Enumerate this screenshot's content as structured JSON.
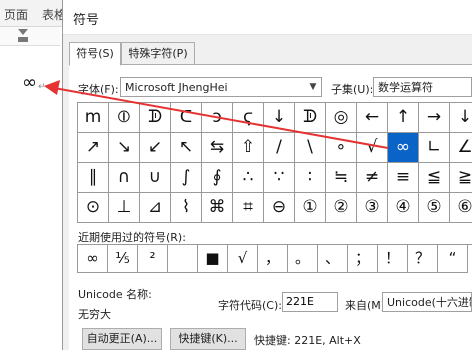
{
  "word": {
    "tabs": [
      "页面",
      "表格"
    ],
    "doc_symbol": "∞",
    "paragraph_mark": "↵"
  },
  "dialog": {
    "title": "符号",
    "tabs": [
      {
        "label": "符号(S)",
        "active": true
      },
      {
        "label": "特殊字符(P)",
        "active": false
      }
    ],
    "font_label": "字体(F):",
    "font_value": "Microsoft JhengHei",
    "subset_label": "子集(U):",
    "subset_value": "数学运算符",
    "symbol_grid": [
      [
        "m",
        "⦶",
        "ᗫ",
        "ᑕ",
        "ↄ",
        "ϛ",
        "↓",
        "ᗫ",
        "◎",
        "←",
        "↑",
        "→",
        "↓"
      ],
      [
        "↗",
        "↘",
        "↙",
        "↖",
        "⇆",
        "⇧",
        "/",
        "\\",
        "∘",
        "√",
        "∞",
        "∟",
        "∠"
      ],
      [
        "∥",
        "∩",
        "∪",
        "∫",
        "∮",
        "∴",
        "∵",
        "∶",
        "≒",
        "≠",
        "≡",
        "≦",
        "≧"
      ],
      [
        "⊙",
        "⊥",
        "⊿",
        "⌇",
        "⌘",
        "⌗",
        "⊖",
        "①",
        "②",
        "③",
        "④",
        "⑤",
        "⑥"
      ]
    ],
    "selected_symbol": "∞",
    "recent_label": "近期使用过的符号(R):",
    "recent_symbols": [
      "∞",
      "⅕",
      "²",
      "",
      "■",
      "√",
      "，",
      "。",
      "、",
      "；",
      "！",
      "？",
      "“"
    ],
    "unicode_name_label": "Unicode 名称:",
    "unicode_name_value": "无穷大",
    "char_code_label": "字符代码(C):",
    "char_code_value": "221E",
    "from_label": "来自(M):",
    "from_value": "Unicode(十六进制)",
    "autocorrect_button": "自动更正(A)...",
    "shortcut_button": "快捷键(K)...",
    "shortcut_text": "快捷键: 221E, Alt+X"
  },
  "annotation": {
    "color": "#e63232"
  }
}
